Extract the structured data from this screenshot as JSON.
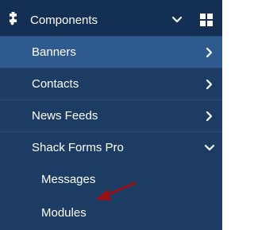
{
  "menu": {
    "section": {
      "label": "Components",
      "icon": "puzzle-icon",
      "toggle_icon": "chevron-down-icon",
      "dashboard_icon": "grid-icon"
    },
    "items": [
      {
        "label": "Banners",
        "state": "active",
        "chevron": "chevron-right-icon"
      },
      {
        "label": "Contacts",
        "chevron": "chevron-right-icon"
      },
      {
        "label": "News Feeds",
        "chevron": "chevron-right-icon"
      },
      {
        "label": "Shack Forms Pro",
        "chevron": "chevron-down-icon"
      }
    ],
    "children": [
      {
        "label": "Messages"
      },
      {
        "label": "Modules"
      }
    ]
  },
  "colors": {
    "sidebar_bg": "#132f53",
    "item_bg": "#1d3c63",
    "active_bg": "#2f5a8e",
    "text": "#ffffff",
    "annotation_arrow": "#9b0f16"
  },
  "annotation": {
    "type": "arrow",
    "target": "Modules"
  }
}
